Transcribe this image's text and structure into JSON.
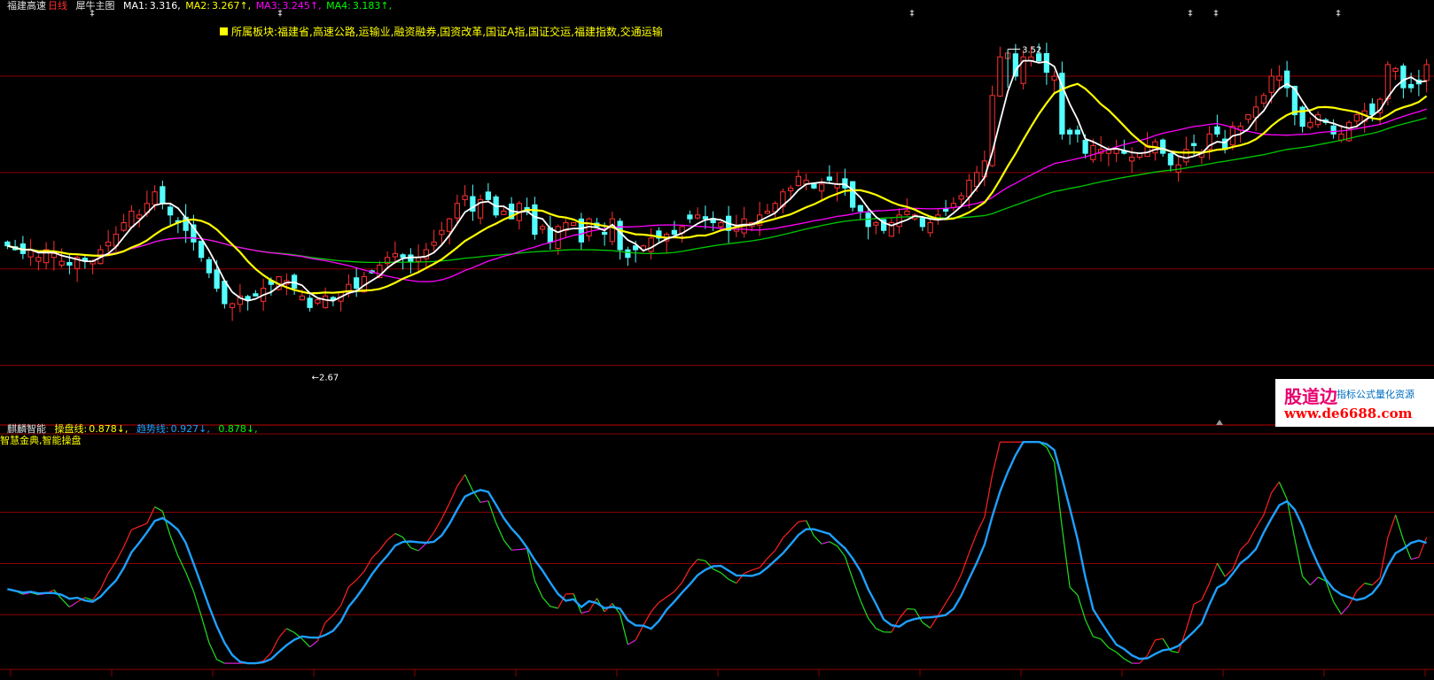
{
  "header": {
    "stock_name": "福建高速",
    "period": "日线",
    "main_chart_name": "犀牛主图",
    "ma1": {
      "label": "MA1:",
      "value": "3.316,"
    },
    "ma2": {
      "label": "MA2:",
      "value": "3.267↑,"
    },
    "ma3": {
      "label": "MA3:",
      "value": "3.245↑,"
    },
    "ma4": {
      "label": "MA4:",
      "value": "3.183↑,"
    }
  },
  "sector": {
    "label": "所属板块:",
    "values": "福建省,高速公路,运输业,融资融券,国资改革,国证A指,国证交运,福建指数,交通运输"
  },
  "annotations": {
    "high_label": "3.52",
    "low_label": "←2.67"
  },
  "sub_header": {
    "indicator_name": "麒麟智能",
    "line1": {
      "label": "操盘线:",
      "value": "0.878↓,"
    },
    "line2": {
      "label": "趋势线:",
      "value": "0.927↓,"
    },
    "line3": {
      "value": "0.878↓,"
    },
    "subtitle": "智慧金典,智能操盘"
  },
  "watermark": {
    "brand": "股道边",
    "slogan": "指标公式量化资源",
    "url": "www.de6688.com"
  },
  "colors": {
    "background": "#000000",
    "grid": "#8b0000",
    "up_candle": "#ff3030",
    "down_candle": "#54ffff",
    "ma1": "#ffffff",
    "ma2": "#ffff00",
    "ma3": "#ff00ff",
    "ma4": "#00c800",
    "trend_line": "#1ea0ff"
  },
  "chart_data": [
    {
      "type": "candlestick",
      "name": "price",
      "ylim": [
        2.55,
        3.62
      ],
      "gridlines": [
        3.45,
        3.2,
        2.95,
        2.7
      ],
      "ohlc_count": 171,
      "close": [
        3.01,
        3.0,
        2.99,
        3.0,
        2.98,
        3.0,
        2.99,
        2.97,
        2.96,
        2.98,
        2.97,
        2.97,
        3.0,
        3.02,
        3.04,
        3.07,
        3.1,
        3.09,
        3.12,
        3.15,
        3.12,
        3.09,
        3.07,
        3.05,
        3.02,
        2.98,
        2.94,
        2.9,
        2.86,
        2.86,
        2.88,
        2.87,
        2.88,
        2.9,
        2.91,
        2.93,
        2.92,
        2.9,
        2.88,
        2.85,
        2.87,
        2.88,
        2.87,
        2.89,
        2.91,
        2.9,
        2.93,
        2.94,
        2.96,
        2.98,
        2.99,
        2.98,
        2.97,
        2.98,
        3.0,
        3.02,
        3.05,
        3.08,
        3.12,
        3.14,
        3.1,
        3.13,
        3.13,
        3.09,
        3.1,
        3.08,
        3.12,
        3.1,
        3.04,
        3.06,
        3.02,
        3.06,
        3.07,
        3.07,
        3.02,
        3.08,
        3.06,
        3.04,
        3.08,
        3.0,
        2.98,
        3.0,
        3.01,
        3.03,
        3.03,
        3.04,
        3.04,
        3.06,
        3.08,
        3.09,
        3.08,
        3.07,
        3.07,
        3.05,
        3.06,
        3.08,
        3.07,
        3.09,
        3.1,
        3.12,
        3.15,
        3.16,
        3.19,
        3.18,
        3.16,
        3.17,
        3.18,
        3.17,
        3.16,
        3.11,
        3.1,
        3.06,
        3.07,
        3.05,
        3.07,
        3.09,
        3.1,
        3.09,
        3.06,
        3.07,
        3.09,
        3.1,
        3.12,
        3.14,
        3.18,
        3.2,
        3.23,
        3.4,
        3.5,
        3.51,
        3.45,
        3.5,
        3.5,
        3.49,
        3.46,
        3.45,
        3.3,
        3.3,
        3.3,
        3.25,
        3.27,
        3.26,
        3.26,
        3.26,
        3.25,
        3.24,
        3.25,
        3.27,
        3.28,
        3.25,
        3.22,
        3.22,
        3.26,
        3.27,
        3.25,
        3.3,
        3.3,
        3.26,
        3.32,
        3.32,
        3.35,
        3.37,
        3.4,
        3.45,
        3.45,
        3.42,
        3.35,
        3.32,
        3.33,
        3.35,
        3.33,
        3.3,
        3.3,
        3.33,
        3.35,
        3.36,
        3.35,
        3.39,
        3.48,
        3.47,
        3.42,
        3.42,
        3.43,
        3.48
      ]
    },
    {
      "type": "line",
      "name": "indicator",
      "ylim": [
        0.0,
        1.8
      ],
      "series": [
        {
          "name": "操盘线"
        },
        {
          "name": "趋势线"
        }
      ]
    }
  ]
}
